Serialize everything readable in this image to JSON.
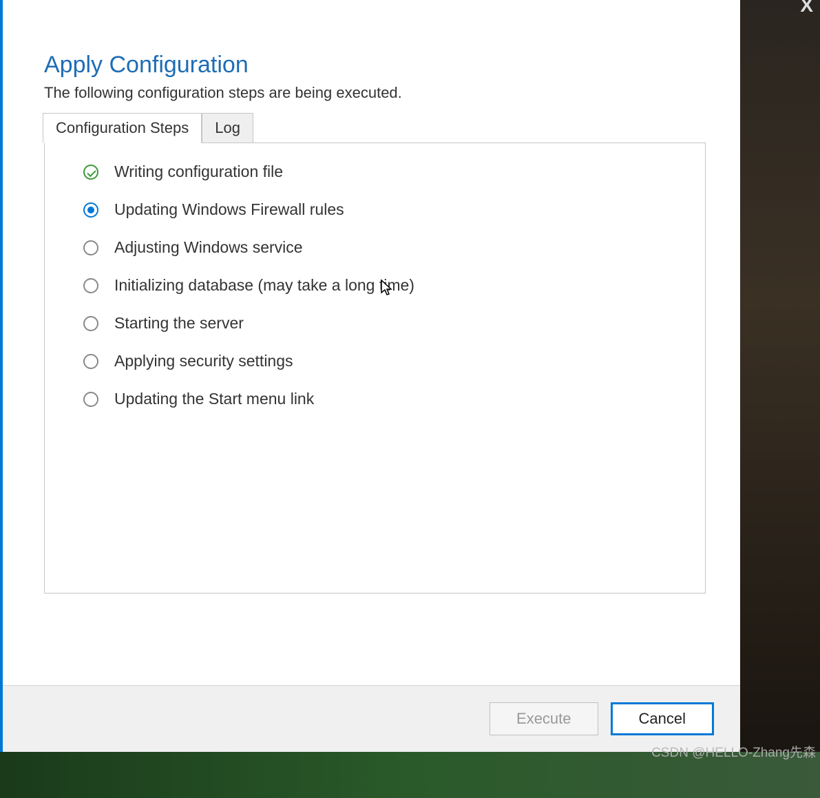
{
  "header": {
    "title": "Apply Configuration",
    "subtitle": "The following configuration steps are being executed."
  },
  "tabs": [
    {
      "label": "Configuration Steps",
      "active": true
    },
    {
      "label": "Log",
      "active": false
    }
  ],
  "steps": [
    {
      "label": "Writing configuration file",
      "status": "done"
    },
    {
      "label": "Updating Windows Firewall rules",
      "status": "current"
    },
    {
      "label": "Adjusting Windows service",
      "status": "pending"
    },
    {
      "label": "Initializing database (may take a long time)",
      "status": "pending"
    },
    {
      "label": "Starting the server",
      "status": "pending"
    },
    {
      "label": "Applying security settings",
      "status": "pending"
    },
    {
      "label": "Updating the Start menu link",
      "status": "pending"
    }
  ],
  "buttons": {
    "execute": "Execute",
    "cancel": "Cancel"
  },
  "watermark": "CSDN @HELLO-Zhang先森"
}
